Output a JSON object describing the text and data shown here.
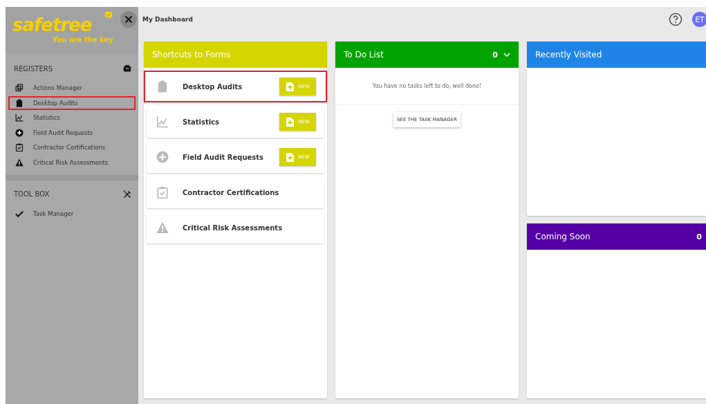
{
  "logo": {
    "name": "safetree",
    "tagline": "You are the key"
  },
  "sidebar": {
    "sections": [
      {
        "title": "REGISTERS",
        "kind": "box",
        "items": [
          {
            "label": "Actions Manager",
            "kind": "copy",
            "highlighted": false
          },
          {
            "label": "Desktop Audits",
            "kind": "clipboard",
            "highlighted": true
          },
          {
            "label": "Statistics",
            "kind": "chart",
            "highlighted": false
          },
          {
            "label": "Field Audit Requests",
            "kind": "plus",
            "highlighted": false
          },
          {
            "label": "Contractor Certifications",
            "kind": "check-clipboard",
            "highlighted": false
          },
          {
            "label": "Critical Risk Assessments",
            "kind": "warning",
            "highlighted": false
          }
        ]
      },
      {
        "title": "TOOL BOX",
        "kind": "tools",
        "items": [
          {
            "label": "Task Manager",
            "kind": "check",
            "highlighted": false
          }
        ]
      }
    ]
  },
  "header": {
    "title": "My Dashboard",
    "avatar": "ET"
  },
  "shortcuts": {
    "title": "Shortcuts to Forms",
    "items": [
      {
        "label": "Desktop Audits",
        "kind": "clipboard",
        "new_button": "NEW",
        "highlighted": true
      },
      {
        "label": "Statistics",
        "kind": "chart",
        "new_button": "NEW",
        "highlighted": false
      },
      {
        "label": "Field Audit Requests",
        "kind": "plus",
        "new_button": "NEW",
        "highlighted": false
      },
      {
        "label": "Contractor Certifications",
        "kind": "check-clipboard",
        "highlighted": false
      },
      {
        "label": "Critical Risk Assessments",
        "kind": "warning",
        "highlighted": false
      }
    ]
  },
  "todo": {
    "title": "To Do List",
    "count": "0",
    "message": "You have no tasks left to do, well done!",
    "button": "SEE THE TASK MANAGER"
  },
  "recently_visited": {
    "title": "Recently Visited"
  },
  "coming_soon": {
    "title": "Coming Soon",
    "count": "0"
  }
}
